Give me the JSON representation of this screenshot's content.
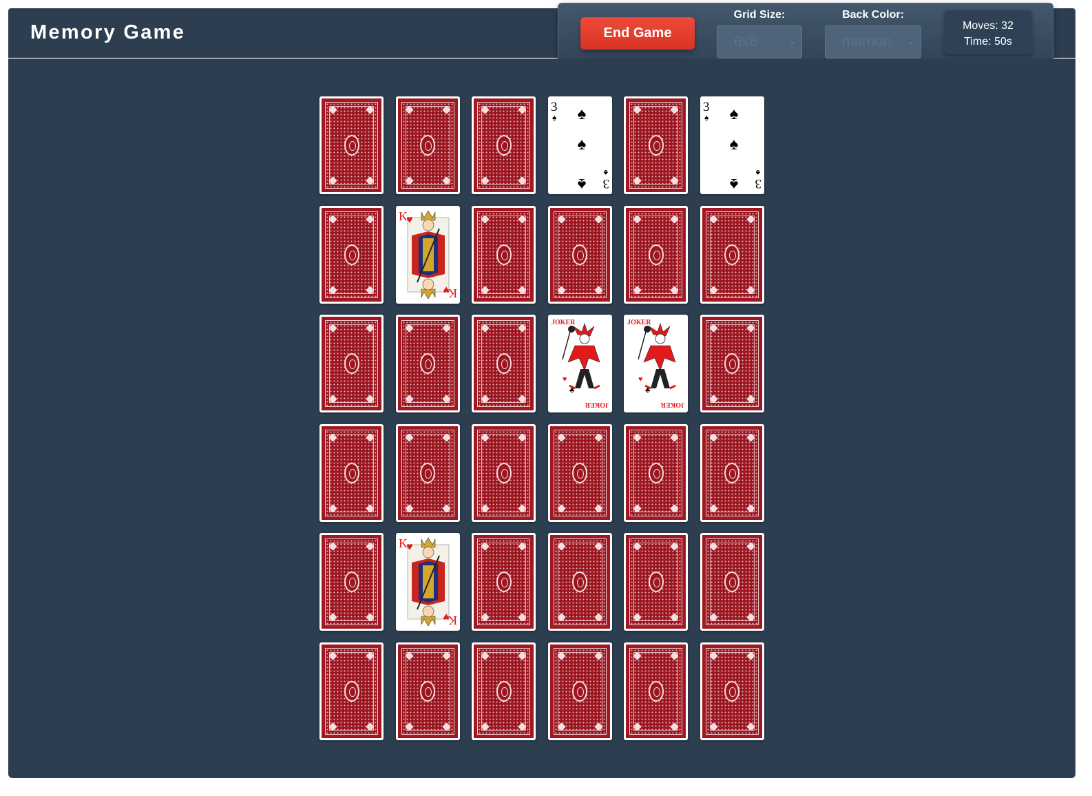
{
  "header": {
    "title": "Memory Game"
  },
  "controls": {
    "end_button_label": "End Game",
    "grid_size_label": "Grid Size:",
    "grid_size_value": "6x6",
    "back_color_label": "Back Color:",
    "back_color_value": "maroon",
    "moves_text": "Moves: 32",
    "time_text": "Time: 50s"
  },
  "board": {
    "back_color": "#a01822",
    "rows": [
      [
        "back",
        "back",
        "back",
        "3-spades",
        "back",
        "3-spades"
      ],
      [
        "back",
        "K-hearts",
        "back",
        "back",
        "back",
        "back"
      ],
      [
        "back",
        "back",
        "back",
        "joker",
        "joker",
        "back"
      ],
      [
        "back",
        "back",
        "back",
        "back",
        "back",
        "back"
      ],
      [
        "back",
        "K-hearts",
        "back",
        "back",
        "back",
        "back"
      ],
      [
        "back",
        "back",
        "back",
        "back",
        "back",
        "back"
      ]
    ]
  },
  "card_faces": {
    "3-spades": {
      "rank": "3",
      "suit": "♠",
      "color": "#000000"
    },
    "K-hearts": {
      "rank": "K",
      "suit": "♥",
      "color": "#e11b1b"
    },
    "joker": {
      "label": "JOKER",
      "color": "#e11b1b"
    }
  }
}
